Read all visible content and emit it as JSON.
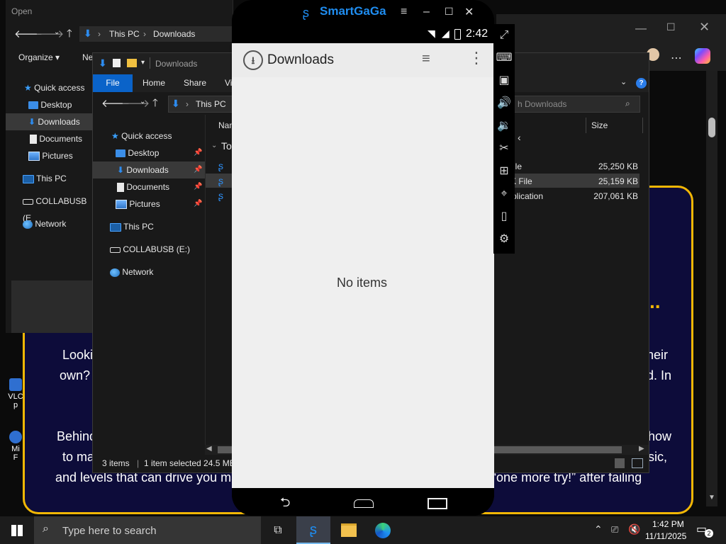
{
  "open_dialog": {
    "title": "Open",
    "address": [
      "This PC",
      "Downloads"
    ],
    "cmd": {
      "organize": "Organize",
      "new": "Ne"
    },
    "tree": [
      {
        "label": "Quick access"
      },
      {
        "label": "Desktop"
      },
      {
        "label": "Downloads"
      },
      {
        "label": "Documents"
      },
      {
        "label": "Pictures"
      },
      {
        "label": "This PC"
      },
      {
        "label": "COLLABUSB (E"
      },
      {
        "label": "Network"
      }
    ]
  },
  "explorer": {
    "title": "Downloads",
    "ribbon_tabs": [
      "File",
      "Home",
      "Share",
      "Vi"
    ],
    "address": [
      "This PC"
    ],
    "search_placeholder": "h Downloads",
    "tree": [
      {
        "label": "Quick access"
      },
      {
        "label": "Desktop"
      },
      {
        "label": "Downloads"
      },
      {
        "label": "Documents"
      },
      {
        "label": "Pictures"
      },
      {
        "label": "This PC"
      },
      {
        "label": "COLLABUSB (E:)"
      },
      {
        "label": "Network"
      }
    ],
    "columns": {
      "name": "Nam",
      "size": "Size"
    },
    "group": "To",
    "rows": [
      {
        "type": "ile",
        "size": "25,250 KB"
      },
      {
        "type": "K File",
        "size": "25,159 KB"
      },
      {
        "type": "plication",
        "size": "207,061 KB"
      }
    ],
    "status": {
      "items": "3 items",
      "selected": "1 item selected  24.5 MB"
    }
  },
  "emulator": {
    "brand": "SmartGaGa",
    "clock": "2:42",
    "app_title": "Downloads",
    "empty_text": "No items"
  },
  "background": {
    "lines": [
      {
        "left": "Looki",
        "right": "heir"
      },
      {
        "left": "own?",
        "right": "d. In"
      },
      {
        "left": "Behind",
        "right": "how"
      },
      {
        "left": "to ma",
        "right": "sic,"
      },
      {
        "left": "and levels that can drive you ma",
        "right": "outed “one more try!” after failing"
      }
    ],
    "ellipsis": "D...",
    "desktop_icons": [
      {
        "label": "VLC",
        "sub": "p"
      },
      {
        "label": "Mi",
        "sub": "F"
      }
    ]
  },
  "taskbar": {
    "search_placeholder": "Type here to search",
    "time": "1:42 PM",
    "date": "11/11/2025",
    "notification_count": "2"
  }
}
